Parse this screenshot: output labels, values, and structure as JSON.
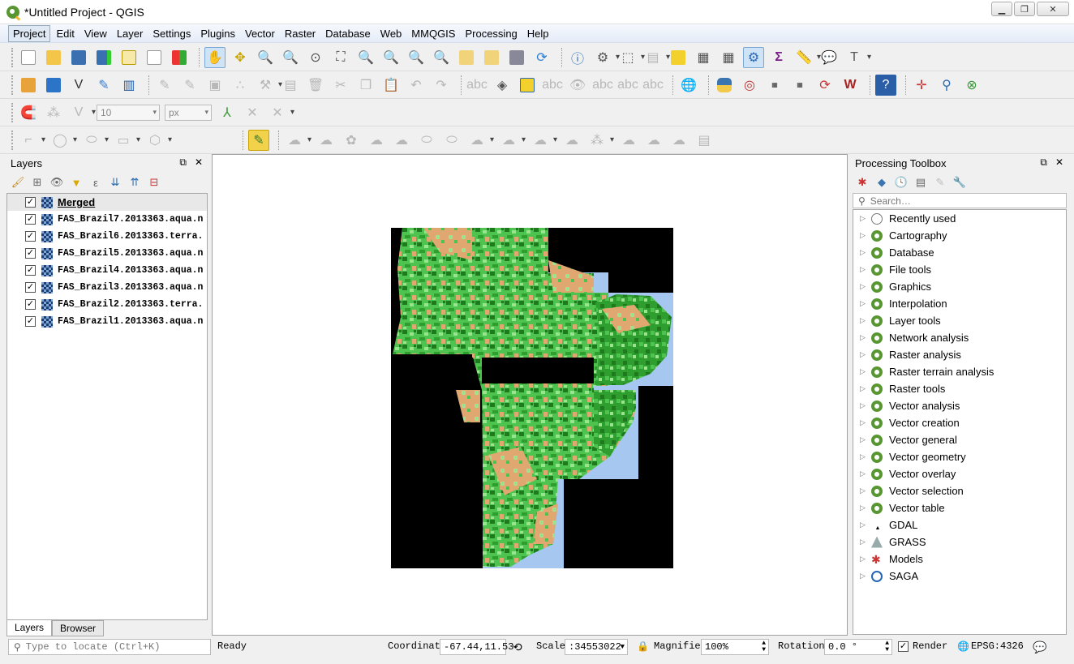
{
  "window": {
    "title": "*Untitled Project - QGIS",
    "min": "▁",
    "max": "❐",
    "close": "✕"
  },
  "menu": [
    "Project",
    "Edit",
    "View",
    "Layer",
    "Settings",
    "Plugins",
    "Vector",
    "Raster",
    "Database",
    "Web",
    "MMQGIS",
    "Processing",
    "Help"
  ],
  "digitize": {
    "value": "10",
    "unit": "px"
  },
  "layers_panel": {
    "title": "Layers",
    "layers": [
      {
        "name": "Merged",
        "checked": true
      },
      {
        "name": "FAS_Brazil7.2013363.aqua.n",
        "checked": true
      },
      {
        "name": "FAS_Brazil6.2013363.terra.",
        "checked": true
      },
      {
        "name": "FAS_Brazil5.2013363.aqua.n",
        "checked": true
      },
      {
        "name": "FAS_Brazil4.2013363.aqua.n",
        "checked": true
      },
      {
        "name": "FAS_Brazil3.2013363.aqua.n",
        "checked": true
      },
      {
        "name": "FAS_Brazil2.2013363.terra.",
        "checked": true
      },
      {
        "name": "FAS_Brazil1.2013363.aqua.n",
        "checked": true
      }
    ],
    "tabs": [
      "Layers",
      "Browser"
    ]
  },
  "toolbox": {
    "title": "Processing Toolbox",
    "search_placeholder": "Search…",
    "items": [
      {
        "label": "Recently used",
        "icon": "clock"
      },
      {
        "label": "Cartography",
        "icon": "qgis"
      },
      {
        "label": "Database",
        "icon": "qgis"
      },
      {
        "label": "File tools",
        "icon": "qgis"
      },
      {
        "label": "Graphics",
        "icon": "qgis"
      },
      {
        "label": "Interpolation",
        "icon": "qgis"
      },
      {
        "label": "Layer tools",
        "icon": "qgis"
      },
      {
        "label": "Network analysis",
        "icon": "qgis"
      },
      {
        "label": "Raster analysis",
        "icon": "qgis"
      },
      {
        "label": "Raster terrain analysis",
        "icon": "qgis"
      },
      {
        "label": "Raster tools",
        "icon": "qgis"
      },
      {
        "label": "Vector analysis",
        "icon": "qgis"
      },
      {
        "label": "Vector creation",
        "icon": "qgis"
      },
      {
        "label": "Vector general",
        "icon": "qgis"
      },
      {
        "label": "Vector geometry",
        "icon": "qgis"
      },
      {
        "label": "Vector overlay",
        "icon": "qgis"
      },
      {
        "label": "Vector selection",
        "icon": "qgis"
      },
      {
        "label": "Vector table",
        "icon": "qgis"
      },
      {
        "label": "GDAL",
        "icon": "gdal"
      },
      {
        "label": "GRASS",
        "icon": "grass"
      },
      {
        "label": "Models",
        "icon": "models"
      },
      {
        "label": "SAGA",
        "icon": "saga"
      }
    ]
  },
  "status": {
    "locate_placeholder": "Type to locate (Ctrl+K)",
    "message": "Ready",
    "coordinate_label": "Coordinate",
    "coordinate": "-67.44,11.53",
    "scale_label": "Scale",
    "scale": ":34553022",
    "magnifier_label": "Magnifier",
    "magnifier": "100%",
    "rotation_label": "Rotation",
    "rotation": "0.0 °",
    "render_label": "Render",
    "crs": "EPSG:4326"
  },
  "colors": {
    "water": "#a6c8f0",
    "nodata": "#000000",
    "green_dark": "#1d7a1d",
    "green": "#4fc34f",
    "green_light": "#9be38f",
    "tan": "#e0a870"
  }
}
